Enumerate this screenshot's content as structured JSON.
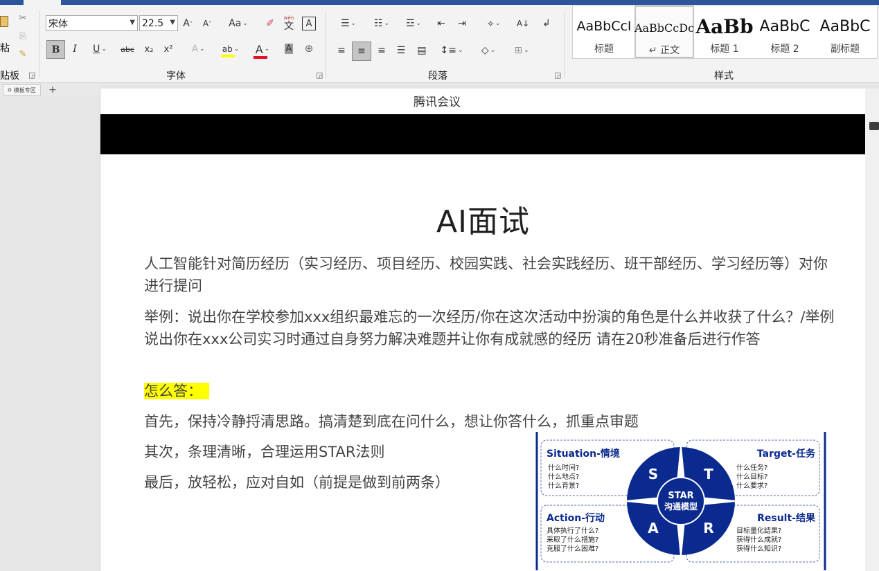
{
  "clipboard": {
    "group_label": "贴板",
    "paste_label": "粘"
  },
  "font": {
    "group_label": "字体",
    "name": "宋体",
    "size": "22.5",
    "grow": "A",
    "shrink": "A",
    "case": "Aa",
    "bold": "B",
    "italic": "I",
    "underline": "U",
    "strike": "abc",
    "sub": "x₂",
    "sup": "x²",
    "highlight": "ab",
    "color": "A",
    "phonetic_top": "wén",
    "phonetic_bottom": "文"
  },
  "paragraph": {
    "group_label": "段落"
  },
  "styles": {
    "group_label": "样式",
    "items": [
      {
        "sample": "AaBbCcI",
        "name": "标题"
      },
      {
        "sample": "AaBbCcDc",
        "name": "↵ 正文"
      },
      {
        "sample": "AaBb",
        "name": "标题 1"
      },
      {
        "sample": "AaBbC",
        "name": "标题 2"
      },
      {
        "sample": "AaBbC",
        "name": "副标题"
      }
    ]
  },
  "tabs": {
    "mini_label": "模板专区",
    "add": "+"
  },
  "document": {
    "header_text": "腾讯会议",
    "title": "AI面试",
    "p1": "人工智能针对简历经历（实习经历、项目经历、校园实践、社会实践经历、班干部经历、学习经历等）对你进行提问",
    "p2": "举例：说出你在学校参加xxx组织最难忘的一次经历/你在这次活动中扮演的角色是什么并收获了什么？/举例说出你在xxx公司实习时通过自身努力解决难题并让你有成就感的经历 请在20秒准备后进行作答",
    "p3": "怎么答：",
    "p4": "首先，保持冷静捋清思路。搞清楚到底在问什么，想让你答什么，抓重点审题",
    "p5": "其次，条理清晰，合理运用STAR法则",
    "p6": "最后，放轻松，应对自如（前提是做到前两条）"
  },
  "star": {
    "center_top": "STAR",
    "center_bottom": "沟通模型",
    "s": "S",
    "t": "T",
    "a": "A",
    "r": "R",
    "situation_title": "Situation-情境",
    "situation_lines": [
      "什么时间?",
      "什么地点?",
      "什么背景?"
    ],
    "target_title": "Target-任务",
    "target_lines": [
      "什么任务?",
      "什么目标?",
      "什么要求?"
    ],
    "action_title": "Action-行动",
    "action_lines": [
      "具体执行了什么?",
      "采取了什么措施?",
      "克服了什么困难?"
    ],
    "result_title": "Result-结果",
    "result_lines": [
      "目标量化结果?",
      "获得什么成就?",
      "获得什么知识?"
    ],
    "color": "#0b2a8f"
  },
  "colors": {
    "ribbon_blue": "#2b579a",
    "highlight": "#ffff00",
    "font_color_bar": "#e81123"
  }
}
